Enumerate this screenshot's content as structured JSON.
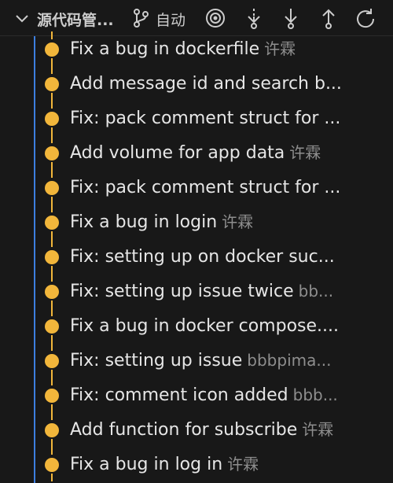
{
  "header": {
    "title": "源代码管...",
    "auto_label": "自动",
    "icons": [
      "chevron-down-icon",
      "git-branch-icon",
      "target-icon",
      "fetch-icon",
      "pull-icon",
      "push-icon",
      "refresh-icon"
    ]
  },
  "colors": {
    "accent": "#3d7fe0",
    "node": "#f2b63b",
    "background": "#181818"
  },
  "commits": [
    {
      "message": "Fix a bug in dockerfile",
      "author": "许霖"
    },
    {
      "message": "Add message id and search b...",
      "author": ""
    },
    {
      "message": "Fix: pack comment struct for ...",
      "author": ""
    },
    {
      "message": "Add volume for app data",
      "author": "许霖"
    },
    {
      "message": "Fix: pack comment struct for ...",
      "author": ""
    },
    {
      "message": "Fix a bug in login",
      "author": "许霖"
    },
    {
      "message": "Fix: setting up on docker suc...",
      "author": ""
    },
    {
      "message": "Fix: setting up issue twice",
      "author": "bb..."
    },
    {
      "message": "Fix a bug in docker compose....",
      "author": ""
    },
    {
      "message": "Fix: setting up issue",
      "author": "bbbpima..."
    },
    {
      "message": "Fix: comment icon added",
      "author": "bbb..."
    },
    {
      "message": "Add function for subscribe",
      "author": "许霖"
    },
    {
      "message": "Fix a bug in log in",
      "author": "许霖"
    }
  ]
}
